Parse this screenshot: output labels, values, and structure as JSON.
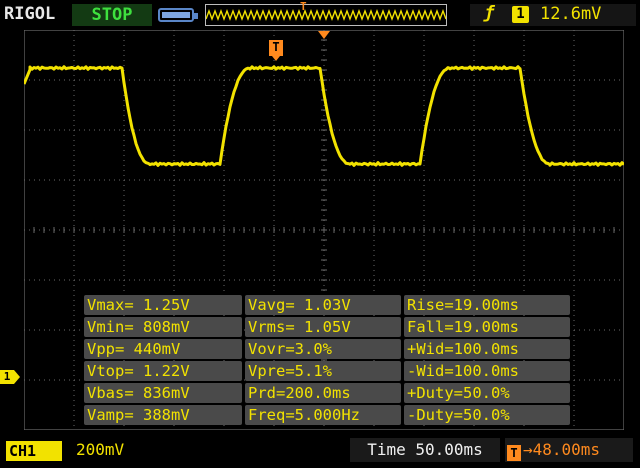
{
  "header": {
    "brand": "RIGOL",
    "run_status": "STOP",
    "trigger_marker_label": "T",
    "trigger_channel": "1",
    "trigger_level": "12.6mV"
  },
  "screen": {
    "trigger_marker_label": "T",
    "channel_marker_label": "1"
  },
  "measurements": [
    [
      "Vmax= 1.25V",
      "Vavg= 1.03V",
      "Rise=19.00ms"
    ],
    [
      "Vmin= 808mV",
      "Vrms= 1.05V",
      "Fall=19.00ms"
    ],
    [
      "Vpp= 440mV",
      "Vovr=3.0%",
      "+Wid=100.0ms"
    ],
    [
      "Vtop= 1.22V",
      "Vpre=5.1%",
      "-Wid=100.0ms"
    ],
    [
      "Vbas= 836mV",
      "Prd=200.0ms",
      "+Duty=50.0%"
    ],
    [
      "Vamp= 388mV",
      "Freq=5.000Hz",
      "-Duty=50.0%"
    ]
  ],
  "footer": {
    "channel_label": "CH1",
    "channel_scale": "200mV",
    "timebase": "Time 50.00ms",
    "delay_icon": "T",
    "delay": "→48.00ms"
  },
  "colors": {
    "ch1": "#f2e200",
    "trigger": "#ff8a1e",
    "status": "#3ee03e"
  }
}
